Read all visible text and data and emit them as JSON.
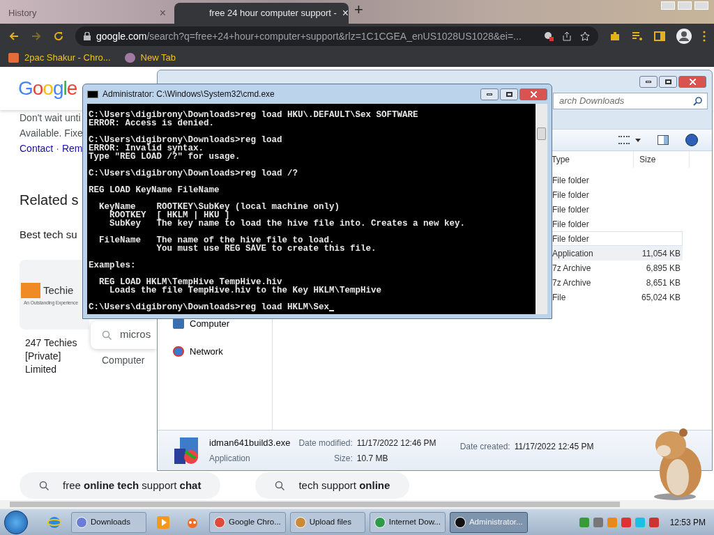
{
  "browser": {
    "tabs": [
      {
        "title": "History",
        "selected": false
      },
      {
        "title": "free 24 hour computer support -",
        "selected": true
      }
    ],
    "close_glyph": "×",
    "new_tab_glyph": "+",
    "url_host": "google.com",
    "url_path": "/search?q=free+24+hour+computer+support&rlz=1C1CGEA_enUS1028US1028&ei=...",
    "bookmarks": [
      "2pac Shakur - Chro...",
      "New Tab"
    ]
  },
  "page": {
    "logo": "Google",
    "snippet": [
      "Don't wait unti",
      "Available. Fixe"
    ],
    "links": [
      "Contact",
      "·",
      "Rem"
    ],
    "related_heading": "Related s",
    "best": "Best tech su",
    "card": {
      "logo_text": "Techie",
      "logo_tagline": "An Outstanding Experience",
      "name_lines": [
        "247 Techies",
        "[Private]",
        "Limited"
      ]
    },
    "suggestion": "micros",
    "suggestion_caption": "Computer",
    "pills": [
      "free **online tech** support **chat**",
      "tech support **online**"
    ]
  },
  "explorer": {
    "search_placeholder": "arch Downloads",
    "columns": [
      "Type",
      "Size"
    ],
    "rows": [
      {
        "type": "File folder",
        "selected": false,
        "hovered": false
      },
      {
        "type": "File folder",
        "selected": false,
        "hovered": false
      },
      {
        "type": "File folder",
        "selected": false,
        "hovered": false
      },
      {
        "type": "File folder",
        "selected": false,
        "hovered": false
      },
      {
        "type": "File folder",
        "selected": false,
        "hovered": true
      },
      {
        "type": "Application",
        "size": "11,054 KB",
        "selected": true,
        "hovered": false
      },
      {
        "type": "7z Archive",
        "size": "6,895 KB",
        "selected": false,
        "hovered": false
      },
      {
        "type": "7z Archive",
        "size": "8,651 KB",
        "selected": false,
        "hovered": false
      },
      {
        "type": "File",
        "size": "65,024 KB",
        "selected": false,
        "hovered": false
      }
    ],
    "nav": [
      "Computer",
      "Network"
    ],
    "details": {
      "name": "idman641build3.exe",
      "type": "Application",
      "modified_label": "Date modified:",
      "modified": "11/17/2022 12:46 PM",
      "size_label": "Size:",
      "size": "10.7 MB",
      "created_label": "Date created:",
      "created": "11/17/2022 12:45 PM"
    }
  },
  "cmd": {
    "title": "Administrator: C:\\Windows\\System32\\cmd.exe",
    "blocks": [
      [
        "C:\\Users\\digibrony\\Downloads>reg load HKU\\.DEFAULT\\Sex SOFTWARE",
        "ERROR: Access is denied."
      ],
      [
        "C:\\Users\\digibrony\\Downloads>reg load",
        "ERROR: Invalid syntax.",
        "Type \"REG LOAD /?\" for usage."
      ],
      [
        "C:\\Users\\digibrony\\Downloads>reg load /?"
      ],
      [
        "REG LOAD KeyName FileName"
      ],
      [
        "  KeyName    ROOTKEY\\SubKey (local machine only)",
        "    ROOTKEY  [ HKLM | HKU ]",
        "    SubKey   The key name to load the hive file into. Creates a new key."
      ],
      [
        "  FileName   The name of the hive file to load.",
        "             You must use REG SAVE to create this file."
      ],
      [
        "Examples:"
      ],
      [
        "  REG LOAD HKLM\\TempHive TempHive.hiv",
        "    Loads the file TempHive.hiv to the Key HKLM\\TempHive"
      ],
      [
        "C:\\Users\\digibrony\\Downloads>reg load HKLM\\Sex"
      ]
    ]
  },
  "taskbar": {
    "items": [
      {
        "kind": "pinned"
      },
      {
        "kind": "window",
        "label": "Downloads",
        "selected": false
      },
      {
        "kind": "pinned"
      },
      {
        "kind": "pinned"
      },
      {
        "kind": "window",
        "label": "Google Chro...",
        "selected": false
      },
      {
        "kind": "window",
        "label": "Upload files",
        "selected": false
      },
      {
        "kind": "window",
        "label": "Internet Dow...",
        "selected": false
      },
      {
        "kind": "window",
        "label": "Administrator...",
        "selected": true
      }
    ],
    "clock": "12:53 PM"
  }
}
